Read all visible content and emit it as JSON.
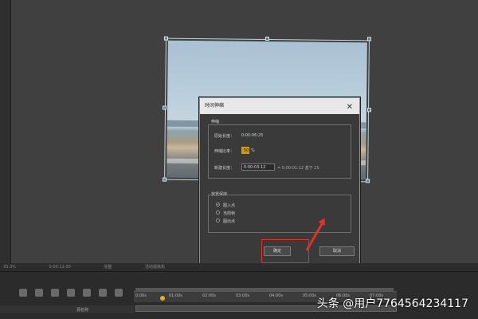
{
  "dialog": {
    "title": "时间伸缩",
    "close_icon": "close-icon",
    "stretch_group": {
      "label": "伸缩",
      "original_duration_label": "原始长度：",
      "original_duration_value": "0:00:06:25",
      "stretch_factor_label": "伸缩比率：",
      "stretch_factor_value": "50",
      "stretch_factor_unit": "%",
      "new_duration_label": "新建长度：",
      "new_duration_value": "0:00:03:12",
      "new_duration_note": "= 0:00:01:12  基于 25"
    },
    "hold_group": {
      "label": "放置保持",
      "options": [
        "图入点",
        "当前帧",
        "图出点"
      ],
      "selected": 0
    },
    "buttons": {
      "ok": "确定",
      "cancel": "取消"
    }
  },
  "status_bar": {
    "zoom": "33.3%",
    "time": "0:00:12:00",
    "view": "完整",
    "camera": "活动摄像机"
  },
  "timeline": {
    "ticks": [
      "0:00s",
      "01:00s",
      "02:00s",
      "03:00s",
      "04:00s",
      "05:00s",
      "06:00s",
      "07:00s"
    ],
    "layer_name": "源名称"
  },
  "watermark": "头条 @用户7764564234117"
}
